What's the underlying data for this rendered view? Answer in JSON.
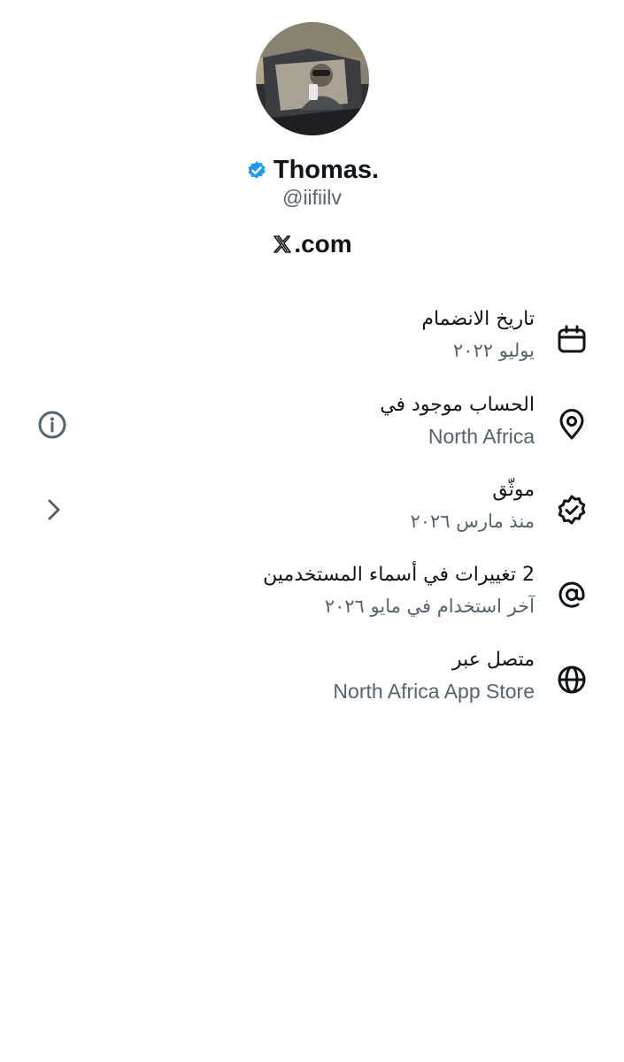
{
  "profile": {
    "display_name": "Thomas.",
    "handle": "@iifiilv",
    "site": ".com",
    "verified_icon": "verified-badge-icon",
    "site_icon": "x-logo-icon"
  },
  "about": {
    "items": [
      {
        "icon": "calendar-icon",
        "title": "تاريخ الانضمام",
        "subtitle": "يوليو ٢٠٢٢"
      },
      {
        "icon": "location-pin-icon",
        "title": "الحساب موجود في",
        "subtitle": "North Africa",
        "side_icon": "info-icon"
      },
      {
        "icon": "verified-check-icon",
        "title": "موثّق",
        "subtitle": "منذ مارس ٢٠٢٦",
        "side_icon": "chevron-right-icon"
      },
      {
        "icon": "at-sign-icon",
        "title": "2 تغييرات في أسماء المستخدمين",
        "subtitle": "آخر استخدام في مايو ٢٠٢٦"
      },
      {
        "icon": "globe-icon",
        "title": "متصل عبر",
        "subtitle": "North Africa App Store"
      }
    ]
  },
  "colors": {
    "text_primary": "#0f1419",
    "text_secondary": "#536471",
    "verified_blue": "#1d9bf0",
    "background": "#ffffff"
  }
}
